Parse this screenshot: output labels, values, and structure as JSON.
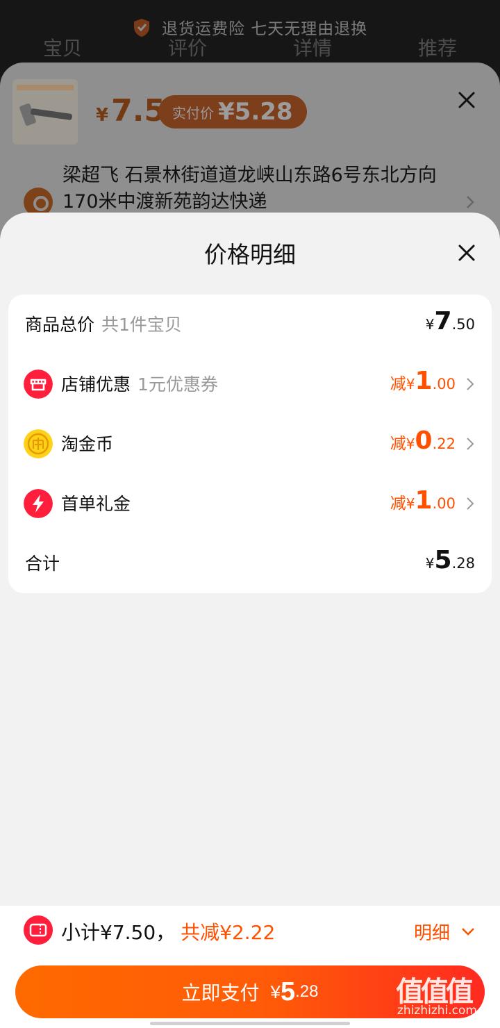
{
  "background": {
    "banner": {
      "text": "退货运费险  七天无理由退换"
    },
    "tabs": [
      "宝贝",
      "评价",
      "详情",
      "推荐"
    ]
  },
  "product_sheet": {
    "price": {
      "currency": "¥",
      "value": "7.5"
    },
    "real_price": {
      "label": "实付价",
      "currency": "¥",
      "value": "5.28"
    },
    "address": "梁超飞  石景林街道道龙峡山东路6号东北方向170米中渡新苑韵达快递"
  },
  "price_detail": {
    "title": "价格明细",
    "rows": [
      {
        "label": "商品总价",
        "sub": "共1件宝贝",
        "prefix": "",
        "currency": "¥",
        "int": "7",
        "dec": ".50",
        "icon": ""
      },
      {
        "label": "店铺优惠",
        "sub": "1元优惠券",
        "prefix": "减",
        "currency": "¥",
        "int": "1",
        "dec": ".00",
        "icon": "shop-icon"
      },
      {
        "label": "淘金币",
        "sub": "",
        "prefix": "减",
        "currency": "¥",
        "int": "0",
        "dec": ".22",
        "icon": "coin-icon"
      },
      {
        "label": "首单礼金",
        "sub": "",
        "prefix": "减",
        "currency": "¥",
        "int": "1",
        "dec": ".00",
        "icon": "lightning-icon"
      },
      {
        "label": "合计",
        "sub": "",
        "prefix": "",
        "currency": "¥",
        "int": "5",
        "dec": ".28",
        "icon": ""
      }
    ]
  },
  "footer": {
    "subtotal": "小计¥7.50，",
    "total_discount": "共减¥2.22",
    "detail_label": "明细",
    "pay": {
      "label": "立即支付",
      "currency": "¥",
      "int": "5",
      "dec": ".28"
    }
  },
  "watermark": {
    "url": "zhizhizhi.com"
  },
  "colors": {
    "accent": "#ff5000",
    "pay_gradient_end": "#ff2a20",
    "sheet_bg": "#f2f2f2"
  }
}
